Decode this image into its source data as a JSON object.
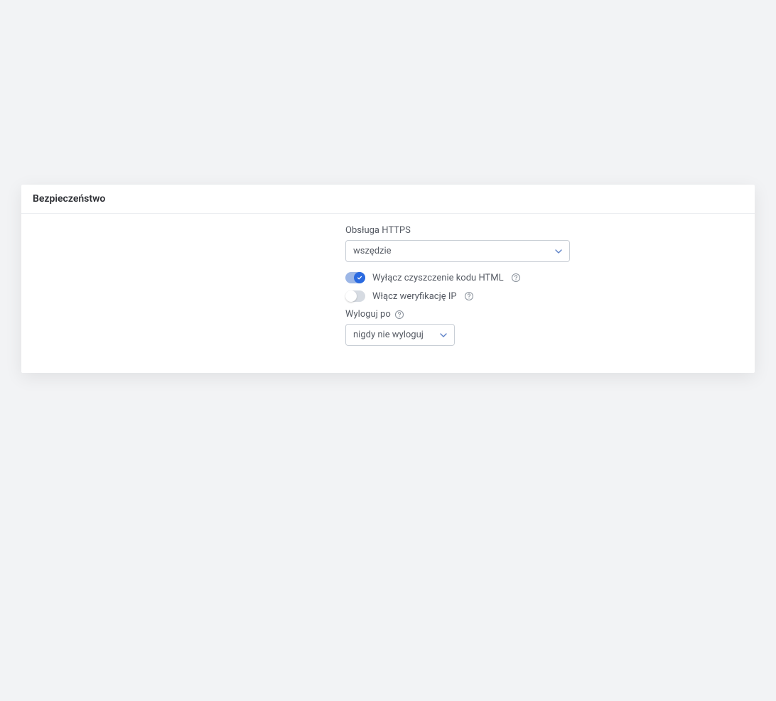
{
  "section": {
    "title": "Bezpieczeństwo"
  },
  "https": {
    "label": "Obsługa HTTPS",
    "value": "wszędzie"
  },
  "disable_html_clean": {
    "label": "Wyłącz czyszczenie kodu HTML",
    "enabled": true
  },
  "ip_verification": {
    "label": "Włącz weryfikację IP",
    "enabled": false
  },
  "logout": {
    "label": "Wyloguj po",
    "value": "nigdy nie wyloguj"
  },
  "colors": {
    "accent": "#2a6ae0",
    "chevron": "#5e82c8",
    "help_icon": "#8a929c"
  }
}
